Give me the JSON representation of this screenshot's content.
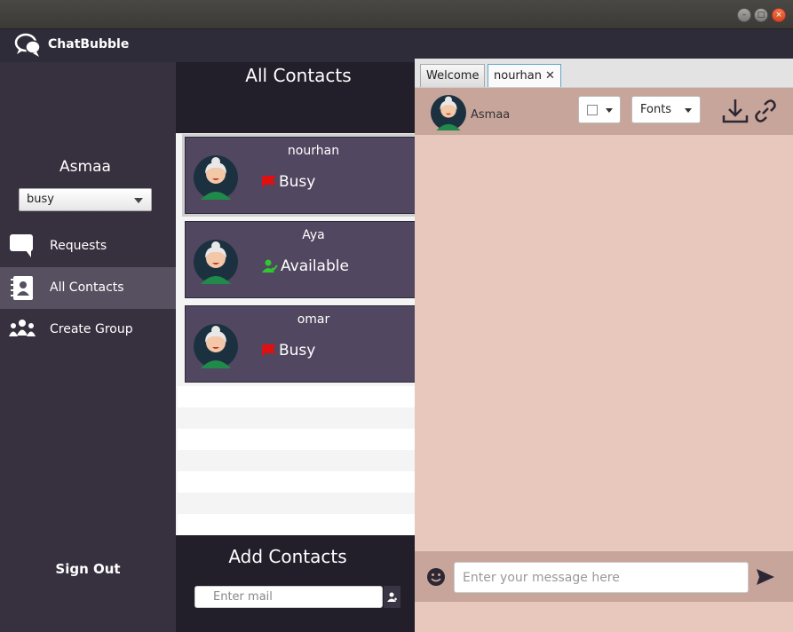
{
  "app": {
    "name": "ChatBubble"
  },
  "window": {
    "buttons": [
      "minimize",
      "maximize",
      "close"
    ]
  },
  "sidebar": {
    "username": "Asmaa",
    "status_value": "busy",
    "items": [
      {
        "label": "Requests",
        "icon": "chat-bubble-icon",
        "active": false
      },
      {
        "label": "All Contacts",
        "icon": "address-book-icon",
        "active": true
      },
      {
        "label": "Create Group",
        "icon": "group-icon",
        "active": false
      }
    ],
    "sign_out": "Sign Out"
  },
  "contacts": {
    "title": "All Contacts",
    "items": [
      {
        "name": "nourhan",
        "status": "Busy",
        "status_icon": "red-flag-icon"
      },
      {
        "name": "Aya",
        "status": "Available",
        "status_icon": "available-user-icon"
      },
      {
        "name": "omar",
        "status": "Busy",
        "status_icon": "red-flag-icon"
      }
    ]
  },
  "add_contacts": {
    "title": "Add Contacts",
    "placeholder": "Enter mail"
  },
  "chat": {
    "tabs": [
      {
        "label": "Welcome",
        "active": false
      },
      {
        "label": "nourhan",
        "active": true
      }
    ],
    "header_name": "Asmaa",
    "fonts_label": "Fonts",
    "message_placeholder": "Enter your message here"
  },
  "colors": {
    "sidebar": "#37313f",
    "card": "#514760",
    "chat_bg": "#e8c8bd",
    "chat_bar": "#c8a59a",
    "busy": "#e01010",
    "available": "#2fc92f"
  }
}
